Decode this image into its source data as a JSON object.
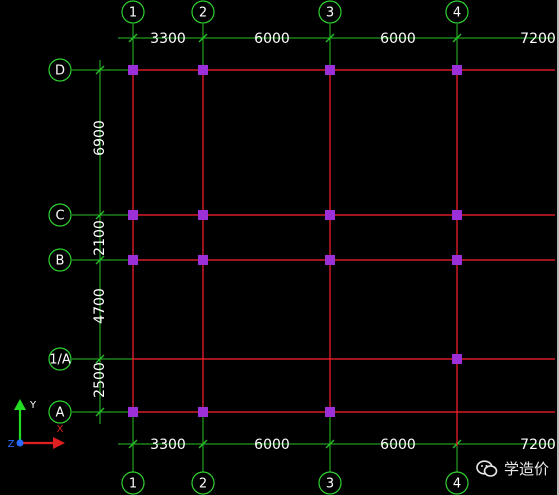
{
  "grid_x": [
    {
      "label": "1",
      "dim_after": "3300"
    },
    {
      "label": "2",
      "dim_after": "6000"
    },
    {
      "label": "3",
      "dim_after": "6000"
    },
    {
      "label": "4",
      "dim_after": "7200"
    }
  ],
  "grid_y": [
    {
      "label": "D",
      "dim_below": "6900"
    },
    {
      "label": "C",
      "dim_below": "2100"
    },
    {
      "label": "B",
      "dim_below": "4700"
    },
    {
      "label": "1/A",
      "dim_below": "2500"
    },
    {
      "label": "A",
      "dim_below": ""
    }
  ],
  "columns": [
    {
      "x": "1",
      "y": "D"
    },
    {
      "x": "2",
      "y": "D"
    },
    {
      "x": "3",
      "y": "D"
    },
    {
      "x": "4",
      "y": "D"
    },
    {
      "x": "1",
      "y": "C"
    },
    {
      "x": "2",
      "y": "C"
    },
    {
      "x": "3",
      "y": "C"
    },
    {
      "x": "4",
      "y": "C"
    },
    {
      "x": "1",
      "y": "B"
    },
    {
      "x": "2",
      "y": "B"
    },
    {
      "x": "3",
      "y": "B"
    },
    {
      "x": "4",
      "y": "B"
    },
    {
      "x": "4",
      "y": "1/A"
    },
    {
      "x": "1",
      "y": "A"
    },
    {
      "x": "2",
      "y": "A"
    },
    {
      "x": "3",
      "y": "A"
    }
  ],
  "ucs": {
    "x_label": "X",
    "y_label": "Y",
    "z_label": "Z"
  },
  "watermark": {
    "text": "学造价"
  },
  "colors": {
    "axis_line": "#ff2030",
    "dimension_line": "#27c227",
    "bubble": "#2fd12f",
    "column": "#9b30d9",
    "background": "#000000"
  }
}
